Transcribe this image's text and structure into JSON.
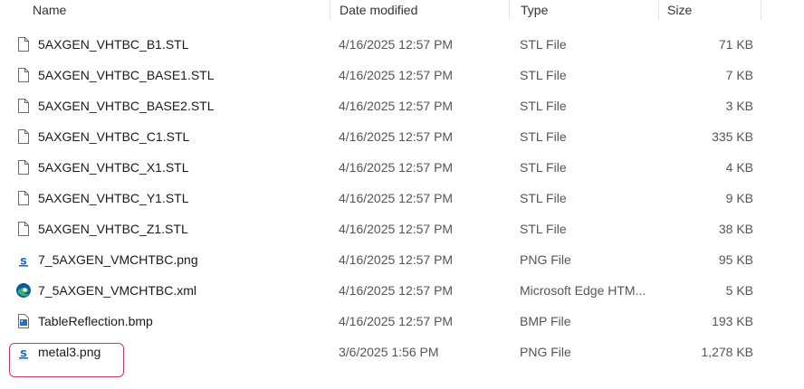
{
  "columns": {
    "name": "Name",
    "date": "Date modified",
    "type": "Type",
    "size": "Size"
  },
  "files": [
    {
      "name": "5AXGEN_VHTBC_B1.STL",
      "date": "4/16/2025 12:57 PM",
      "type": "STL File",
      "size": "71 KB",
      "icon": "document-icon"
    },
    {
      "name": "5AXGEN_VHTBC_BASE1.STL",
      "date": "4/16/2025 12:57 PM",
      "type": "STL File",
      "size": "7 KB",
      "icon": "document-icon"
    },
    {
      "name": "5AXGEN_VHTBC_BASE2.STL",
      "date": "4/16/2025 12:57 PM",
      "type": "STL File",
      "size": "3 KB",
      "icon": "document-icon"
    },
    {
      "name": "5AXGEN_VHTBC_C1.STL",
      "date": "4/16/2025 12:57 PM",
      "type": "STL File",
      "size": "335 KB",
      "icon": "document-icon"
    },
    {
      "name": "5AXGEN_VHTBC_X1.STL",
      "date": "4/16/2025 12:57 PM",
      "type": "STL File",
      "size": "4 KB",
      "icon": "document-icon"
    },
    {
      "name": "5AXGEN_VHTBC_Y1.STL",
      "date": "4/16/2025 12:57 PM",
      "type": "STL File",
      "size": "9 KB",
      "icon": "document-icon"
    },
    {
      "name": "5AXGEN_VHTBC_Z1.STL",
      "date": "4/16/2025 12:57 PM",
      "type": "STL File",
      "size": "38 KB",
      "icon": "document-icon"
    },
    {
      "name": "7_5AXGEN_VMCHTBC.png",
      "date": "4/16/2025 12:57 PM",
      "type": "PNG File",
      "size": "95 KB",
      "icon": "image-app-icon"
    },
    {
      "name": "7_5AXGEN_VMCHTBC.xml",
      "date": "4/16/2025 12:57 PM",
      "type": "Microsoft Edge HTM...",
      "size": "5 KB",
      "icon": "edge-icon"
    },
    {
      "name": "TableReflection.bmp",
      "date": "4/16/2025 12:57 PM",
      "type": "BMP File",
      "size": "193 KB",
      "icon": "bitmap-icon"
    },
    {
      "name": "metal3.png",
      "date": "3/6/2025 1:56 PM",
      "type": "PNG File",
      "size": "1,278 KB",
      "icon": "image-app-icon"
    }
  ],
  "colors": {
    "selection_outline": "#c9376b",
    "image_app_blue": "#1f6fd1",
    "edge_blue": "#0c59a4",
    "edge_green": "#38b56a"
  }
}
